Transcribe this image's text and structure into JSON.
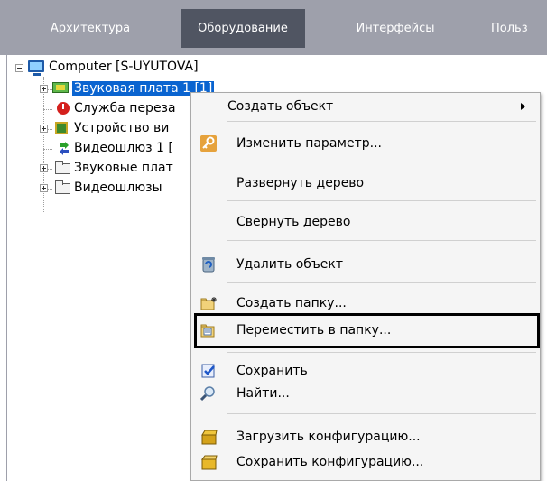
{
  "tabs": [
    {
      "label": "Архитектура"
    },
    {
      "label": "Оборудование"
    },
    {
      "label": "Интерфейсы"
    },
    {
      "label": "Польз"
    }
  ],
  "tree": {
    "root": {
      "label": "Computer [S-UYUTOVA]"
    },
    "items": [
      {
        "label": "Звуковая плата 1 [1]",
        "icon": "sound-card-icon"
      },
      {
        "label": "Служба переза",
        "icon": "power-icon"
      },
      {
        "label": "Устройство ви",
        "icon": "chip-icon"
      },
      {
        "label": "Видеошлюз 1 [",
        "icon": "gateway-icon"
      },
      {
        "label": "Звуковые плат",
        "icon": "folder-icon"
      },
      {
        "label": "Видеошлюзы",
        "icon": "folder-icon"
      }
    ]
  },
  "context_menu": {
    "items": [
      {
        "label": "Создать объект"
      },
      {
        "label": "Изменить параметр..."
      },
      {
        "label": "Развернуть дерево"
      },
      {
        "label": "Свернуть дерево"
      },
      {
        "label": "Удалить объект"
      },
      {
        "label": "Создать папку..."
      },
      {
        "label": "Переместить в папку..."
      },
      {
        "label": "Сохранить"
      },
      {
        "label": "Найти..."
      },
      {
        "label": "Загрузить конфигурацию..."
      },
      {
        "label": "Сохранить конфигурацию..."
      }
    ]
  },
  "colors": {
    "tabbar": "#9ea0ab",
    "active_tab": "#505562",
    "selection": "#0a64d0"
  }
}
